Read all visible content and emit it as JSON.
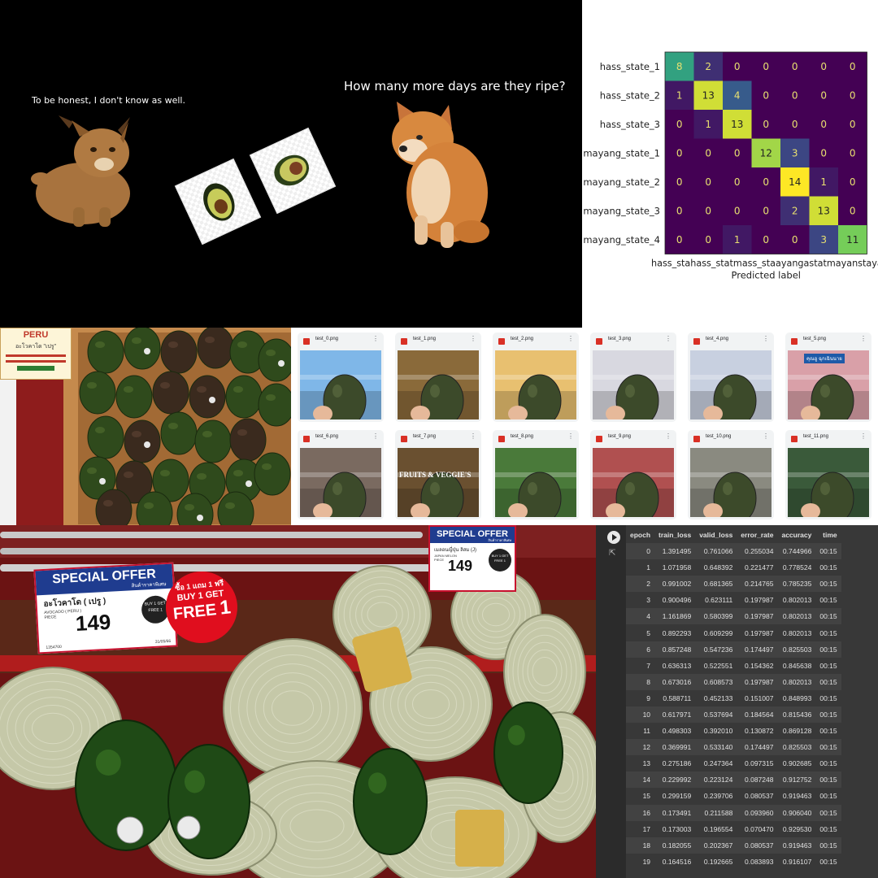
{
  "meme": {
    "caption_left": "To be honest, I don't know as well.",
    "caption_right": "How many more days are they ripe?"
  },
  "confusion_matrix": {
    "labels": [
      "hass_state_1",
      "hass_state_2",
      "hass_state_3",
      "mayang_state_1",
      "mayang_state_2",
      "mayang_state_3",
      "mayang_state_4"
    ],
    "x_tick_text": "hass_stahass_statmass_staayangastatmayanstayangayang_state",
    "xlabel": "Predicted label",
    "matrix": [
      [
        8,
        2,
        0,
        0,
        0,
        0,
        0
      ],
      [
        1,
        13,
        4,
        0,
        0,
        0,
        0
      ],
      [
        0,
        1,
        13,
        0,
        0,
        0,
        0
      ],
      [
        0,
        0,
        0,
        12,
        3,
        0,
        0
      ],
      [
        0,
        0,
        0,
        0,
        14,
        1,
        0
      ],
      [
        0,
        0,
        0,
        0,
        2,
        13,
        0
      ],
      [
        0,
        0,
        1,
        0,
        0,
        3,
        11
      ]
    ]
  },
  "box_photo": {
    "sign_line1": "PERU",
    "sign_line2": "อะโวคาโด \"เปรู\""
  },
  "thumbnails": [
    {
      "name": "test_0.png"
    },
    {
      "name": "test_1.png"
    },
    {
      "name": "test_2.png"
    },
    {
      "name": "test_3.png"
    },
    {
      "name": "test_4.png"
    },
    {
      "name": "test_5.png"
    },
    {
      "name": "test_6.png"
    },
    {
      "name": "test_7.png"
    },
    {
      "name": "test_8.png"
    },
    {
      "name": "test_9.png"
    },
    {
      "name": "test_10.png"
    },
    {
      "name": "test_11.png"
    }
  ],
  "thumbnail_texts": {
    "store_sign": "คุณอู ฉุกเฉินนาย",
    "fruits_sign": "FRUITS & VEGGIE'S"
  },
  "market": {
    "offer1": {
      "banner": "SPECIAL OFFER",
      "sub": "สินค้าราคาพิเศษ",
      "product": "อะโวคาโด ( เปรู )",
      "product_en": "AVOCADO ( PERU )",
      "unit": "PIECE",
      "price": "149",
      "badge": "BUY 1 GET FREE 1",
      "code": "1354700",
      "date": "31/05/66"
    },
    "promo": {
      "thai": "ซื้อ 1 แถม 1 ฟรี",
      "line1": "BUY 1 GET",
      "line2": "FREE",
      "num": "1"
    },
    "offer2": {
      "banner": "SPECIAL OFFER",
      "sub": "สินค้าราคาพิเศษ",
      "product": "เมลอนญี่ปุ่น ลิสม (J)",
      "product_en": "JAPAN MELON",
      "unit": "PIECE",
      "price": "149",
      "badge": "BUY 1 GET FREE 1"
    }
  },
  "training": {
    "columns": [
      "epoch",
      "train_loss",
      "valid_loss",
      "error_rate",
      "accuracy",
      "time"
    ],
    "rows": [
      [
        "0",
        "1.391495",
        "0.761066",
        "0.255034",
        "0.744966",
        "00:15"
      ],
      [
        "1",
        "1.071958",
        "0.648392",
        "0.221477",
        "0.778524",
        "00:15"
      ],
      [
        "2",
        "0.991002",
        "0.681365",
        "0.214765",
        "0.785235",
        "00:15"
      ],
      [
        "3",
        "0.900496",
        "0.623111",
        "0.197987",
        "0.802013",
        "00:15"
      ],
      [
        "4",
        "1.161869",
        "0.580399",
        "0.197987",
        "0.802013",
        "00:15"
      ],
      [
        "5",
        "0.892293",
        "0.609299",
        "0.197987",
        "0.802013",
        "00:15"
      ],
      [
        "6",
        "0.857248",
        "0.547236",
        "0.174497",
        "0.825503",
        "00:15"
      ],
      [
        "7",
        "0.636313",
        "0.522551",
        "0.154362",
        "0.845638",
        "00:15"
      ],
      [
        "8",
        "0.673016",
        "0.608573",
        "0.197987",
        "0.802013",
        "00:15"
      ],
      [
        "9",
        "0.588711",
        "0.452133",
        "0.151007",
        "0.848993",
        "00:15"
      ],
      [
        "10",
        "0.617971",
        "0.537694",
        "0.184564",
        "0.815436",
        "00:15"
      ],
      [
        "11",
        "0.498303",
        "0.392010",
        "0.130872",
        "0.869128",
        "00:15"
      ],
      [
        "12",
        "0.369991",
        "0.533140",
        "0.174497",
        "0.825503",
        "00:15"
      ],
      [
        "13",
        "0.275186",
        "0.247364",
        "0.097315",
        "0.902685",
        "00:15"
      ],
      [
        "14",
        "0.229992",
        "0.223124",
        "0.087248",
        "0.912752",
        "00:15"
      ],
      [
        "15",
        "0.299159",
        "0.239706",
        "0.080537",
        "0.919463",
        "00:15"
      ],
      [
        "16",
        "0.173491",
        "0.211588",
        "0.093960",
        "0.906040",
        "00:15"
      ],
      [
        "17",
        "0.173003",
        "0.196554",
        "0.070470",
        "0.929530",
        "00:15"
      ],
      [
        "18",
        "0.182055",
        "0.202367",
        "0.080537",
        "0.919463",
        "00:15"
      ],
      [
        "19",
        "0.164516",
        "0.192665",
        "0.083893",
        "0.916107",
        "00:15"
      ]
    ]
  }
}
